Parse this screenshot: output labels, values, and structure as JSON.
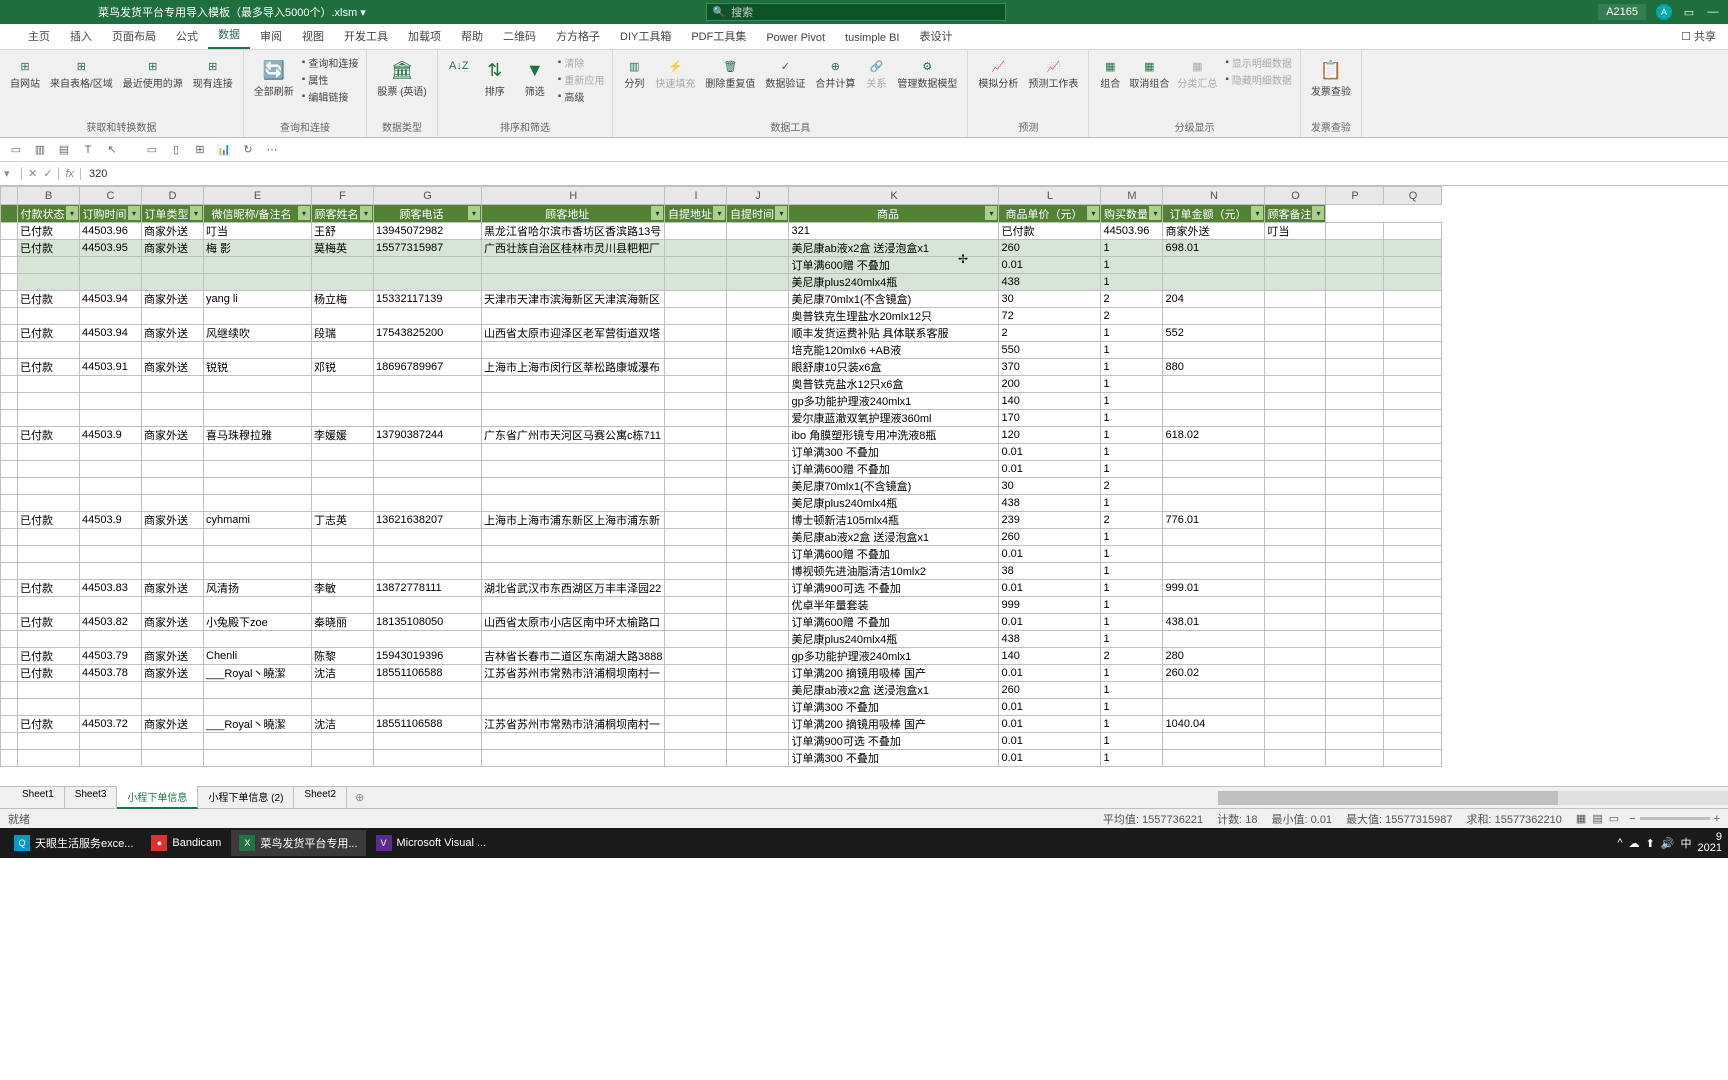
{
  "title": "菜鸟发货平台专用导入模板（最多导入5000个）.xlsm ▾",
  "search_placeholder": "搜索",
  "cell_ref": "A2165",
  "avatar_initial": "A",
  "ribbon_tabs": [
    "主页",
    "插入",
    "页面布局",
    "公式",
    "数据",
    "审阅",
    "视图",
    "开发工具",
    "加载项",
    "帮助",
    "二维码",
    "方方格子",
    "DIY工具箱",
    "PDF工具集",
    "Power Pivot",
    "tusimple BI",
    "表设计"
  ],
  "active_tab": "数据",
  "share_label": "共享",
  "ribbon": {
    "get_data": {
      "items": [
        "自网站",
        "来自表格/区域",
        "最近使用的源",
        "现有连接"
      ],
      "label": "获取和转换数据"
    },
    "refresh": {
      "btn": "全部刷新",
      "list": [
        "查询和连接",
        "属性",
        "编辑链接"
      ],
      "label": "查询和连接"
    },
    "stocks": {
      "btn": "股票 (英语)",
      "label": "数据类型"
    },
    "sort": {
      "btn": "排序",
      "filter": "筛选",
      "list": [
        "清除",
        "重新应用",
        "高级"
      ],
      "label": "排序和筛选"
    },
    "tools": {
      "items": [
        "分列",
        "快速填充",
        "删除重复值",
        "数据验证",
        "合并计算",
        "关系",
        "管理数据模型"
      ],
      "label": "数据工具"
    },
    "forecast": {
      "items": [
        "模拟分析",
        "预测工作表"
      ],
      "label": "预测"
    },
    "outline": {
      "items": [
        "组合",
        "取消组合",
        "分类汇总"
      ],
      "list": [
        "显示明细数据",
        "隐藏明细数据"
      ],
      "label": "分级显示"
    },
    "invoice": {
      "btn": "发票查验",
      "label": "发票查验"
    }
  },
  "formula_value": "320",
  "columns": [
    "",
    "B",
    "C",
    "D",
    "E",
    "F",
    "G",
    "H",
    "I",
    "J",
    "K",
    "L",
    "M",
    "N",
    "O",
    "P",
    "Q"
  ],
  "headers": [
    "",
    "付款状态",
    "订购时间",
    "订单类型",
    "微信昵称/备注名",
    "顾客姓名",
    "顾客电话",
    "顾客地址",
    "自提地址",
    "自提时间",
    "商品",
    "商品单价（元）",
    "购买数量",
    "订单金额（元）",
    "顾客备注"
  ],
  "rows": [
    {
      "b": "已付款",
      "c": "44503.96",
      "d": "商家外送",
      "e": "叮当",
      "f": "王舒",
      "g": "13945072982",
      "h": "黑龙江省哈尔滨市香坊区香滨路13号",
      "k": "321",
      "l": "已付款",
      "m": "44503.96",
      "n": "商家外送",
      "o": "叮当"
    },
    {
      "sel": true,
      "b": "已付款",
      "c": "44503.95",
      "d": "商家外送",
      "e": "梅 影",
      "f": "莫梅英",
      "g": "15577315987",
      "h": "广西壮族自治区桂林市灵川县粑粑厂",
      "k": "美尼康ab液x2盒 送浸泡盒x1",
      "l": "260",
      "m": "1",
      "n": "698.01"
    },
    {
      "sel": true,
      "k": "订单满600赠 不叠加",
      "l": "0.01",
      "m": "1"
    },
    {
      "sel": true,
      "k": "美尼康plus240mlx4瓶",
      "l": "438",
      "m": "1"
    },
    {
      "b": "已付款",
      "c": "44503.94",
      "d": "商家外送",
      "e": "yang li",
      "f": "杨立梅",
      "g": "15332117139",
      "h": "天津市天津市滨海新区天津滨海新区",
      "k": "美尼康70mlx1(不含镜盒)",
      "l": "30",
      "m": "2",
      "n": "204"
    },
    {
      "k": "奥普铁克生理盐水20mlx12只",
      "l": "72",
      "m": "2"
    },
    {
      "b": "已付款",
      "c": "44503.94",
      "d": "商家外送",
      "e": "风继续吹",
      "f": "段瑞",
      "g": "17543825200",
      "h": "山西省太原市迎泽区老军营街道双塔",
      "k": "顺丰发货运费补贴 具体联系客服",
      "l": "2",
      "m": "1",
      "n": "552"
    },
    {
      "k": "培克能120mlx6 +AB液",
      "l": "550",
      "m": "1"
    },
    {
      "b": "已付款",
      "c": "44503.91",
      "d": "商家外送",
      "e": "锐锐",
      "f": "邓锐",
      "g": "18696789967",
      "h": "上海市上海市闵行区莘松路康城瀑布",
      "k": "眼舒康10只装x6盒",
      "l": "370",
      "m": "1",
      "n": "880"
    },
    {
      "k": "奥普铁克盐水12只x6盒",
      "l": "200",
      "m": "1"
    },
    {
      "k": "gp多功能护理液240mlx1",
      "l": "140",
      "m": "1"
    },
    {
      "k": "爱尔康蓝澈双氧护理液360ml",
      "l": "170",
      "m": "1"
    },
    {
      "b": "已付款",
      "c": "44503.9",
      "d": "商家外送",
      "e": "喜马珠穆拉雅",
      "f": "李媛媛",
      "g": "13790387244",
      "h": "广东省广州市天河区马赛公寓c栋711",
      "k": "ibo 角膜塑形镜专用冲洗液8瓶",
      "l": "120",
      "m": "1",
      "n": "618.02"
    },
    {
      "k": "订单满300 不叠加",
      "l": "0.01",
      "m": "1"
    },
    {
      "k": "订单满600赠 不叠加",
      "l": "0.01",
      "m": "1"
    },
    {
      "k": "美尼康70mlx1(不含镜盒)",
      "l": "30",
      "m": "2"
    },
    {
      "k": "美尼康plus240mlx4瓶",
      "l": "438",
      "m": "1"
    },
    {
      "b": "已付款",
      "c": "44503.9",
      "d": "商家外送",
      "e": "cyhmami",
      "f": "丁志英",
      "g": "13621638207",
      "h": "上海市上海市浦东新区上海市浦东新",
      "k": "博士顿新洁105mlx4瓶",
      "l": "239",
      "m": "2",
      "n": "776.01"
    },
    {
      "k": "美尼康ab液x2盒 送浸泡盒x1",
      "l": "260",
      "m": "1"
    },
    {
      "k": "订单满600赠 不叠加",
      "l": "0.01",
      "m": "1"
    },
    {
      "k": "博视顿先进油脂清洁10mlx2",
      "l": "38",
      "m": "1"
    },
    {
      "b": "已付款",
      "c": "44503.83",
      "d": "商家外送",
      "e": "风清扬",
      "f": "李敏",
      "g": "13872778111",
      "h": "湖北省武汉市东西湖区万丰丰泽园22",
      "k": "订单满900可选 不叠加",
      "l": "0.01",
      "m": "1",
      "n": "999.01"
    },
    {
      "k": "优卓半年量套装",
      "l": "999",
      "m": "1"
    },
    {
      "b": "已付款",
      "c": "44503.82",
      "d": "商家外送",
      "e": "小兔殿下zoe",
      "f": "秦晓丽",
      "g": "18135108050",
      "h": "山西省太原市小店区南中环太榆路口",
      "k": "订单满600赠 不叠加",
      "l": "0.01",
      "m": "1",
      "n": "438.01"
    },
    {
      "k": "美尼康plus240mlx4瓶",
      "l": "438",
      "m": "1"
    },
    {
      "b": "已付款",
      "c": "44503.79",
      "d": "商家外送",
      "e": "Chenli",
      "f": "陈黎",
      "g": "15943019396",
      "h": "吉林省长春市二道区东南湖大路3888",
      "k": "gp多功能护理液240mlx1",
      "l": "140",
      "m": "2",
      "n": "280"
    },
    {
      "b": "已付款",
      "c": "44503.78",
      "d": "商家外送",
      "e": "___Royal丶曉潔",
      "f": "沈洁",
      "g": "18551106588",
      "h": "江苏省苏州市常熟市浒浦桐坝南村一",
      "k": "订单满200 摘镜用吸棒 国产",
      "l": "0.01",
      "m": "1",
      "n": "260.02"
    },
    {
      "k": "美尼康ab液x2盒 送浸泡盒x1",
      "l": "260",
      "m": "1"
    },
    {
      "k": "订单满300 不叠加",
      "l": "0.01",
      "m": "1"
    },
    {
      "b": "已付款",
      "c": "44503.72",
      "d": "商家外送",
      "e": "___Royal丶曉潔",
      "f": "沈洁",
      "g": "18551106588",
      "h": "江苏省苏州市常熟市浒浦桐坝南村一",
      "k": "订单满200 摘镜用吸棒 国产",
      "l": "0.01",
      "m": "1",
      "n": "1040.04"
    },
    {
      "k": "订单满900可选 不叠加",
      "l": "0.01",
      "m": "1"
    },
    {
      "k": "订单满300 不叠加",
      "l": "0.01",
      "m": "1"
    }
  ],
  "sheets": [
    "Sheet1",
    "Sheet3",
    "小程下单信息",
    "小程下单信息 (2)",
    "Sheet2"
  ],
  "active_sheet": "小程下单信息",
  "status": {
    "ready": "就绪",
    "avg": "平均值: 1557736221",
    "count": "计数: 18",
    "min": "最小值: 0.01",
    "max": "最大值: 15577315987",
    "sum": "求和: 15577362210"
  },
  "taskbar": {
    "items": [
      {
        "icon": "Q",
        "color": "#0099cc",
        "label": "天眼生活服务exce..."
      },
      {
        "icon": "●",
        "color": "#e03030",
        "label": "Bandicam"
      },
      {
        "icon": "X",
        "color": "#217346",
        "label": "菜鸟发货平台专用..."
      },
      {
        "icon": "V",
        "color": "#5b2d8e",
        "label": "Microsoft Visual ..."
      }
    ],
    "time": "9\n2021"
  }
}
